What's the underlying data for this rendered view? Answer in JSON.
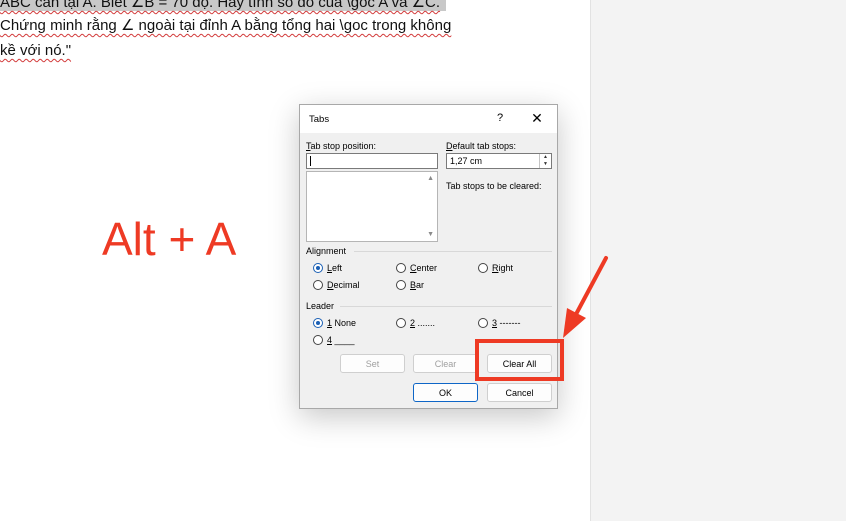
{
  "document": {
    "line1": "ABC cân tại A. Biết ∠B = 70 độ. Hãy tính số đo của \\góc A và ∠C.",
    "line2": "Chứng minh rằng ∠ ngoài tại đỉnh A bằng tổng hai \\goc trong không",
    "line3": "kề với nó.\""
  },
  "annotation": {
    "hotkey": "Alt + A",
    "color": "#ee3a24"
  },
  "dialog": {
    "title": "Tabs",
    "help": "?",
    "close": "✕",
    "tab_stop_position_label": "Tab stop position:",
    "tab_stop_position_value": "",
    "default_tab_stops_label": "Default tab stops:",
    "default_tab_stops_value": "1,27 cm",
    "tab_stops_to_clear_label": "Tab stops to be cleared:",
    "alignment_label": "Alignment",
    "alignment_options": [
      "Left",
      "Center",
      "Right",
      "Decimal",
      "Bar"
    ],
    "alignment_selected": "Left",
    "leader_label": "Leader",
    "leader_options": [
      "1 None",
      "2 .......",
      "3 -------",
      "4 ____"
    ],
    "leader_selected": "1 None",
    "buttons": {
      "set": "Set",
      "clear": "Clear",
      "clear_all": "Clear All",
      "ok": "OK",
      "cancel": "Cancel"
    },
    "accent_color": "#1a5fb4"
  }
}
